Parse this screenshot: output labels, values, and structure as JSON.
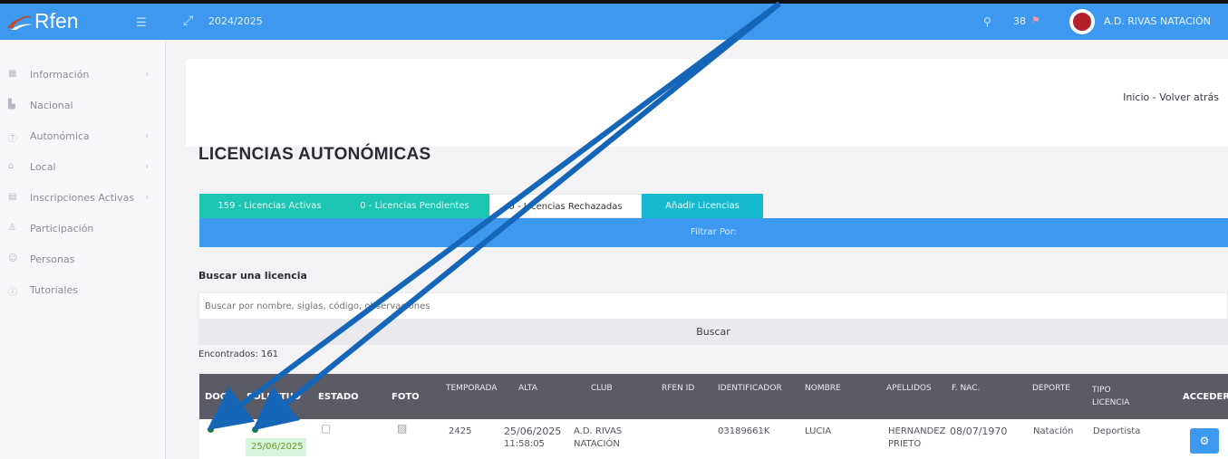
{
  "header": {
    "logo_text": "Rfen",
    "season": "2024/2025",
    "notification_count": "38",
    "club_name": "A.D. RIVAS NATACIÓN"
  },
  "sidebar": {
    "items": [
      {
        "label": "Información",
        "has_arrow": true
      },
      {
        "label": "Nacional",
        "has_arrow": false
      },
      {
        "label": "Autonómica",
        "has_arrow": true
      },
      {
        "label": "Local",
        "has_arrow": true
      },
      {
        "label": "Inscripciones Activas",
        "has_arrow": true
      },
      {
        "label": "Participación",
        "has_arrow": false
      },
      {
        "label": "Personas",
        "has_arrow": false
      },
      {
        "label": "Tutoriales",
        "has_arrow": false
      }
    ]
  },
  "breadcrumb": "Inicio - Volver atrás",
  "page_title": "LICENCIAS AUTONÓMICAS",
  "tabs": [
    {
      "label": "159 - Licencias Activas"
    },
    {
      "label": "0 - Licencias Pendientes"
    },
    {
      "label": "0 - Licencias Rechazadas"
    },
    {
      "label": "Añadir Licencias"
    }
  ],
  "filter_label": "Filtrar Por:",
  "search": {
    "label": "Buscar una licencia",
    "placeholder": "Buscar por nombre, siglas, código, observaciones",
    "button": "Buscar"
  },
  "found_text": "Encontrados: 161",
  "table": {
    "headers": [
      "DOC",
      "SOLICITUD",
      "ESTADO",
      "FOTO",
      "TEMPORADA",
      "ALTA",
      "CLUB",
      "RFEN ID",
      "IDENTIFICADOR",
      "NOMBRE",
      "APELLIDOS",
      "F. NAC.",
      "DEPORTE",
      "TIPO LICENCIA",
      "ACCEDER"
    ],
    "rows": [
      {
        "doc_status": "green",
        "solicitud_date": "25/06/2025",
        "temporada": "2425",
        "alta_date": "25/06/2025",
        "alta_time": "11:58:05",
        "club_line1": "A.D. RIVAS",
        "club_line2": "NATACIÓN",
        "rfen_id": "",
        "identificador": "03189661K",
        "nombre": "LUCIA",
        "apellidos_line1": "HERNANDEZ",
        "apellidos_line2": "PRIETO",
        "f_nac": "08/07/1970",
        "deporte": "Natación",
        "tipo_licencia": "Deportista"
      }
    ]
  },
  "colors": {
    "header_blue": "#3d99f0",
    "tab_teal": "#1dc5b5",
    "tab_cyan": "#17b9ce",
    "status_green": "#1a7a3c",
    "arrow_blue": "#1565b8"
  },
  "icons": {
    "hamburger": "menu-icon",
    "expand": "expand-icon",
    "search": "search-icon",
    "flag": "flag-icon",
    "gear": "gear-icon"
  }
}
